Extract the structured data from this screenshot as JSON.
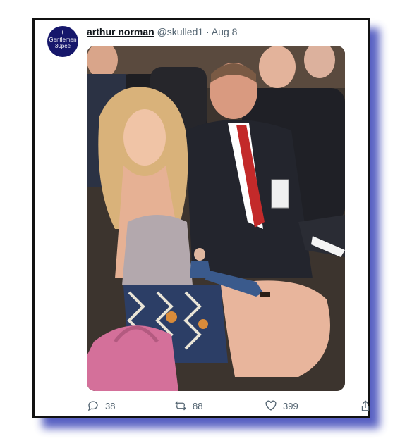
{
  "tweet": {
    "avatar_text_top": "(",
    "avatar_text_line1": "Gentlemen",
    "avatar_text_line2": "30pee",
    "display_name": "arthur norman",
    "handle": "@skulled1",
    "separator": "·",
    "date": "Aug 8",
    "replies": "38",
    "retweets": "88",
    "likes": "399"
  },
  "colors": {
    "frame_shadow": "#3b45b8",
    "avatar_bg": "#16176b",
    "text_muted": "#536471"
  }
}
